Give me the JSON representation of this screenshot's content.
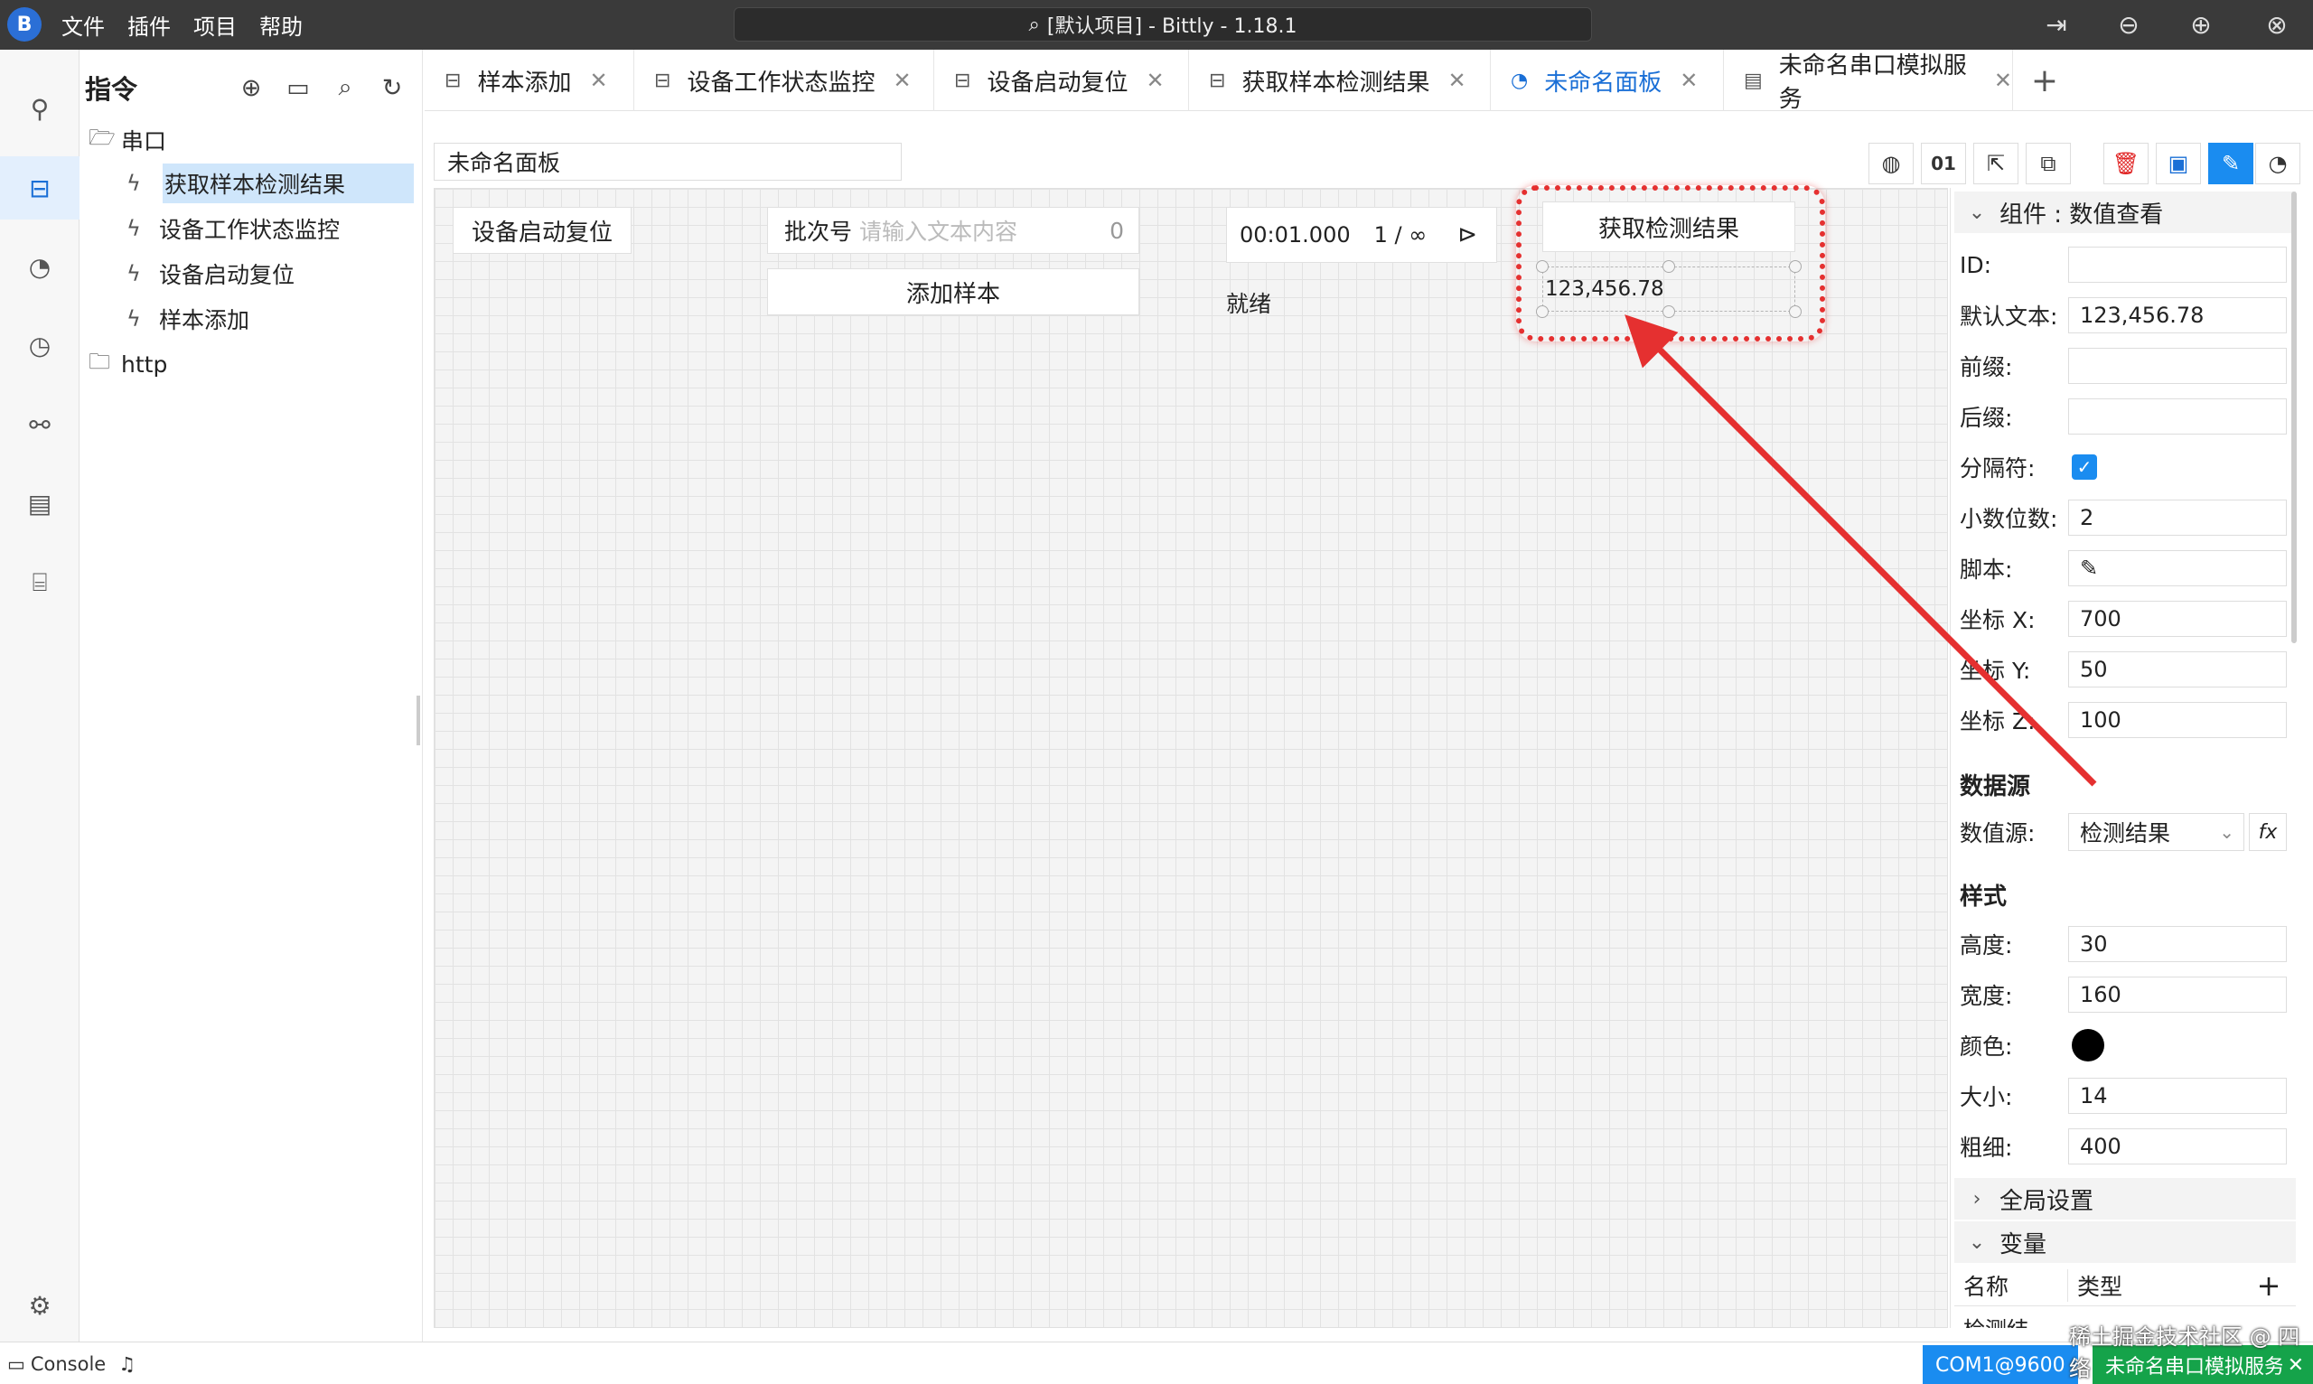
{
  "titlebar": {
    "logo": "B",
    "menu": [
      "文件",
      "插件",
      "项目",
      "帮助"
    ],
    "search": "[默认项目] - Bittly - 1.18.1",
    "controls": [
      "pin-icon",
      "minimize-icon",
      "maximize-icon",
      "close-icon"
    ]
  },
  "activity": [
    "plug-icon",
    "serial-icon",
    "dashboard-icon",
    "timer-icon",
    "flow-icon",
    "list-icon",
    "scan-icon",
    "settings-icon"
  ],
  "sidebar": {
    "title": "指令",
    "tree": {
      "folder1": "串口",
      "items": [
        "获取样本检测结果",
        "设备工作状态监控",
        "设备启动复位",
        "样本添加"
      ],
      "folder2": "http"
    }
  },
  "tabs": [
    {
      "label": "样本添加",
      "icon": "serial-icon"
    },
    {
      "label": "设备工作状态监控",
      "icon": "serial-icon"
    },
    {
      "label": "设备启动复位",
      "icon": "serial-icon"
    },
    {
      "label": "获取样本检测结果",
      "icon": "serial-icon"
    },
    {
      "label": "未命名面板",
      "icon": "dashboard-icon",
      "active": true
    },
    {
      "label": "未命名串口模拟服务",
      "icon": "document-icon"
    }
  ],
  "panel": {
    "name": "未命名面板",
    "toolbar": {
      "hex_label": "01"
    }
  },
  "widgets": {
    "reset_button": "设备启动复位",
    "batch_label": "批次号",
    "batch_placeholder": "请输入文本内容",
    "batch_count": "0",
    "add_sample_button": "添加样本",
    "timer_time": "00:01.000",
    "timer_count": "1 / ∞",
    "status_text": "就绪",
    "get_result_button": "获取检测结果",
    "value_display": "123,456.78"
  },
  "props": {
    "header": "组件 : 数值查看",
    "fields": {
      "id_label": "ID:",
      "id_value": "",
      "default_label": "默认文本:",
      "default_value": "123,456.78",
      "prefix_label": "前缀:",
      "prefix_value": "",
      "suffix_label": "后缀:",
      "suffix_value": "",
      "separator_label": "分隔符:",
      "decimals_label": "小数位数:",
      "decimals_value": "2",
      "script_label": "脚本:",
      "x_label": "坐标 X:",
      "x_value": "700",
      "y_label": "坐标 Y:",
      "y_value": "50",
      "z_label": "坐标 Z:",
      "z_value": "100"
    },
    "datasource_title": "数据源",
    "datasource_label": "数值源:",
    "datasource_value": "检测结果",
    "fx": "fx",
    "style_title": "样式",
    "style": {
      "height_label": "高度:",
      "height_value": "30",
      "width_label": "宽度:",
      "width_value": "160",
      "color_label": "颜色:",
      "color_value": "#000000",
      "size_label": "大小:",
      "size_value": "14",
      "weight_label": "粗细:",
      "weight_value": "400"
    },
    "global_settings": "全局设置",
    "variables": "变量",
    "var_col_name": "名称",
    "var_col_type": "类型",
    "var_row_partial": "检测结"
  },
  "statusbar": {
    "console": "Console",
    "com": "COM1@9600",
    "service": "未命名串口模拟服务",
    "watermark": "稀土掘金技术社区 @ 四络"
  },
  "colors": {
    "accent": "#1a8cf0",
    "annotation": "#e53030",
    "status_green": "#15a34a"
  }
}
